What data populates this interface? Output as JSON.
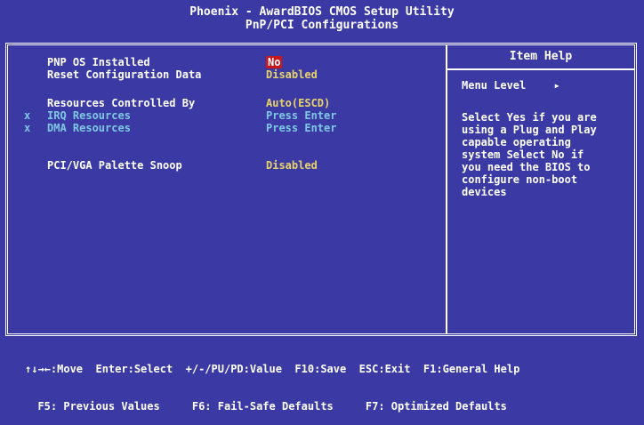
{
  "header": {
    "title_line1": "Phoenix - AwardBIOS CMOS Setup Utility",
    "title_line2": "PnP/PCI Configurations"
  },
  "settings": [
    {
      "label": "PNP OS Installed",
      "value": "No",
      "selected": true,
      "disabled": false,
      "marker": ""
    },
    {
      "label": "Reset Configuration Data",
      "value": "Disabled",
      "selected": false,
      "disabled": false,
      "marker": ""
    },
    {
      "label": "Resources Controlled By",
      "value": "Auto(ESCD)",
      "selected": false,
      "disabled": false,
      "marker": ""
    },
    {
      "label": "IRQ Resources",
      "value": "Press Enter",
      "selected": false,
      "disabled": true,
      "marker": "x"
    },
    {
      "label": "DMA Resources",
      "value": "Press Enter",
      "selected": false,
      "disabled": true,
      "marker": "x"
    },
    {
      "label": "PCI/VGA Palette Snoop",
      "value": "Disabled",
      "selected": false,
      "disabled": false,
      "marker": ""
    }
  ],
  "help": {
    "title": "Item Help",
    "menu_level_label": "Menu Level",
    "menu_level_arrow": "▸",
    "text": "Select Yes if you are\nusing a Plug and Play\ncapable operating\nsystem Select No if\nyou need the BIOS to\nconfigure non-boot\ndevices"
  },
  "footer": {
    "line1": "↑↓→←:Move  Enter:Select  +/-/PU/PD:Value  F10:Save  ESC:Exit  F1:General Help",
    "line2": "  F5: Previous Values     F6: Fail-Safe Defaults     F7: Optimized Defaults"
  },
  "colors": {
    "background": "#3b3aa4",
    "value": "#e8d36a",
    "disabled": "#7ec8e3",
    "selected_bg": "#c8171c"
  }
}
